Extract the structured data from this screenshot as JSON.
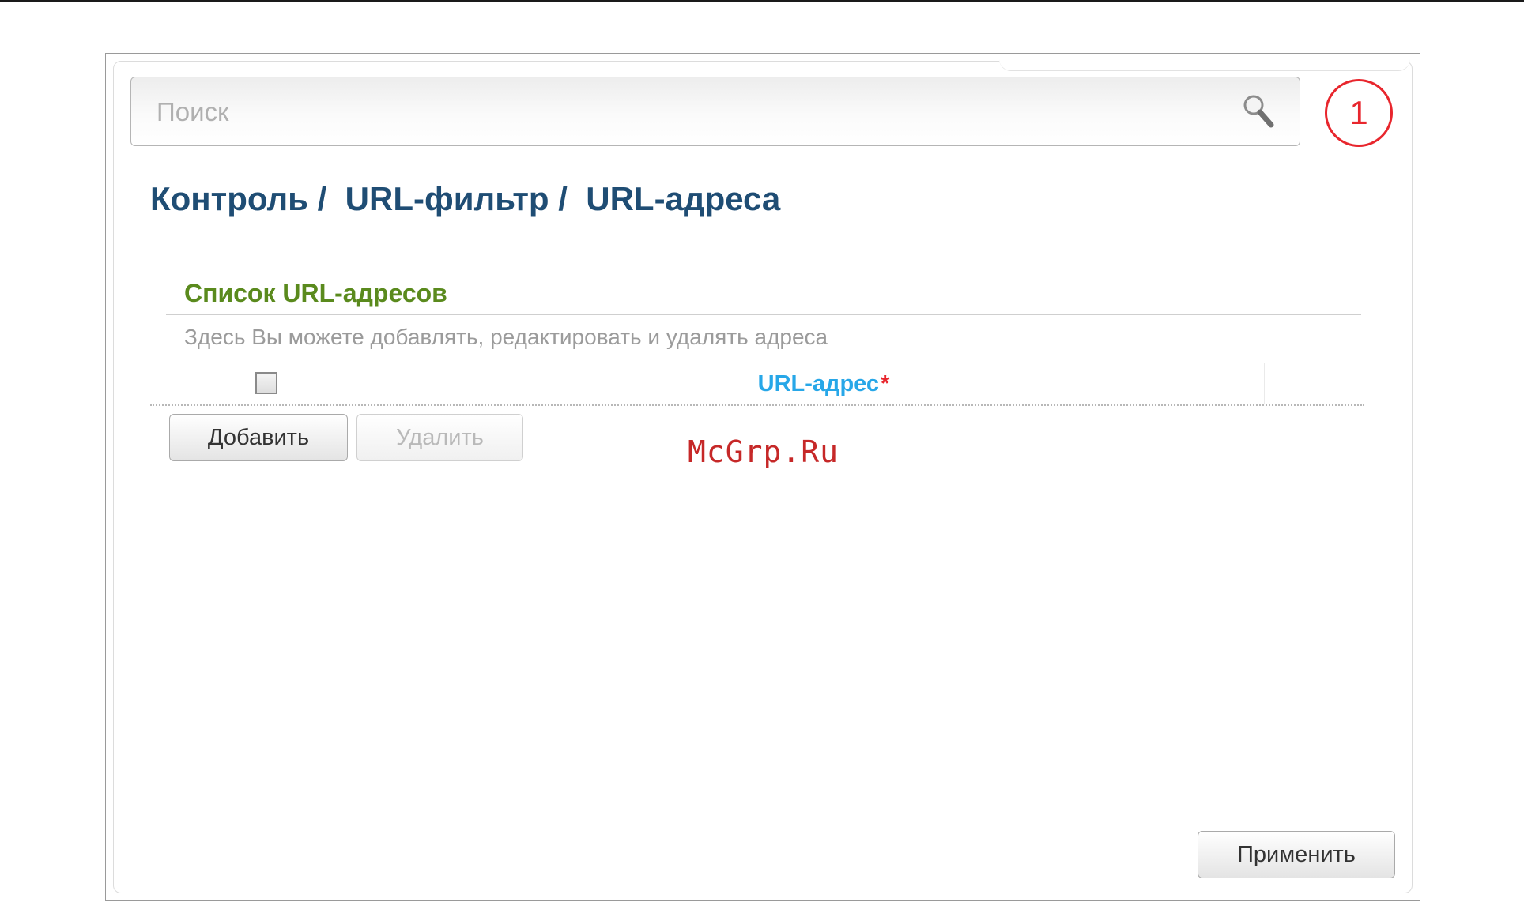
{
  "search": {
    "placeholder": "Поиск"
  },
  "step_badge": "1",
  "breadcrumb": "Контроль /  URL-фильтр /  URL-адреса",
  "section": {
    "title": "Список URL-адресов",
    "description": "Здесь Вы можете добавлять, редактировать и удалять адреса"
  },
  "table": {
    "columns": [
      "URL-адрес"
    ],
    "required_mark": "*",
    "select_all_checked": false
  },
  "buttons": {
    "add": "Добавить",
    "delete": "Удалить",
    "apply": "Применить"
  },
  "watermark": "McGrp.Ru",
  "colors": {
    "title": "#1f4d74",
    "section_title": "#5a8a1d",
    "column_header": "#27a7e8",
    "accent_red": "#e8262d"
  },
  "icons": {
    "search": "search-icon"
  }
}
